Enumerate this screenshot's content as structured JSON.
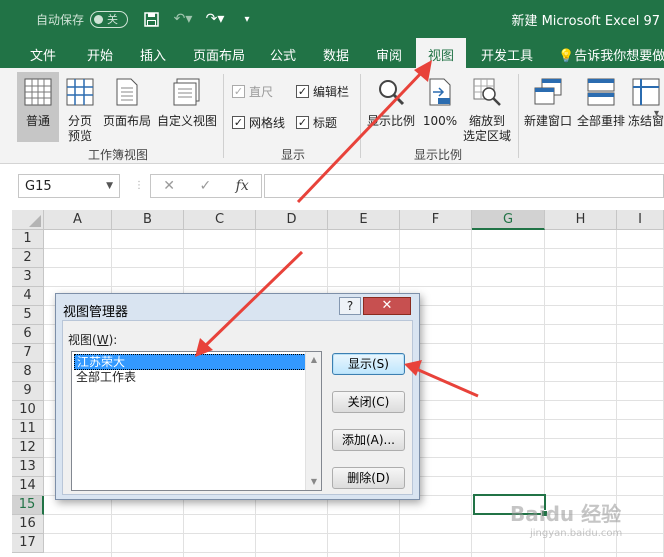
{
  "titlebar": {
    "autosave_label": "自动保存",
    "autosave_state": "关",
    "window_title": "新建 Microsoft Excel 97"
  },
  "tabs": [
    {
      "label": "文件"
    },
    {
      "label": "开始"
    },
    {
      "label": "插入"
    },
    {
      "label": "页面布局"
    },
    {
      "label": "公式"
    },
    {
      "label": "数据"
    },
    {
      "label": "审阅"
    },
    {
      "label": "视图"
    },
    {
      "label": "开发工具"
    },
    {
      "label": "告诉我你想要做什"
    }
  ],
  "ribbon": {
    "workbook_views": {
      "group_label": "工作簿视图",
      "normal": "普通",
      "page_break_line1": "分页",
      "page_break_line2": "预览",
      "page_layout": "页面布局",
      "custom_views": "自定义视图"
    },
    "show": {
      "group_label": "显示",
      "ruler": "直尺",
      "formula_bar": "编辑栏",
      "gridlines": "网格线",
      "headings": "标题"
    },
    "zoom": {
      "group_label": "显示比例",
      "zoom": "显示比例",
      "hundred": "100%",
      "zoom_sel_line1": "缩放到",
      "zoom_sel_line2": "选定区域"
    },
    "window": {
      "new_window": "新建窗口",
      "arrange_all": "全部重排",
      "freeze": "冻结窗"
    }
  },
  "formula_bar": {
    "name_box": "G15",
    "cancel": "✕",
    "enter": "✓",
    "fx": "fx",
    "value": ""
  },
  "grid": {
    "columns": [
      "A",
      "B",
      "C",
      "D",
      "E",
      "F",
      "G",
      "H",
      "I"
    ],
    "rows": [
      "1",
      "2",
      "3",
      "4",
      "5",
      "6",
      "7",
      "8",
      "9",
      "10",
      "11",
      "12",
      "13",
      "14",
      "15",
      "16",
      "17"
    ],
    "selected_column": "G",
    "selected_row": "15"
  },
  "dialog": {
    "title": "视图管理器",
    "help": "?",
    "close": "✕",
    "list_label": "视图(",
    "list_label_key": "W",
    "list_label_end": "):",
    "views": [
      "江苏荣大",
      "全部工作表"
    ],
    "selected_view": 0,
    "buttons": {
      "show": "显示(S)",
      "close": "关闭(C)",
      "add": "添加(A)...",
      "delete": "删除(D)"
    }
  },
  "watermark": {
    "text": "Baidu 经验",
    "sub": "jingyan.baidu.com"
  },
  "colors": {
    "excel_green": "#217346",
    "arrow_red": "#e8423a",
    "selection_blue": "#3399ff"
  }
}
